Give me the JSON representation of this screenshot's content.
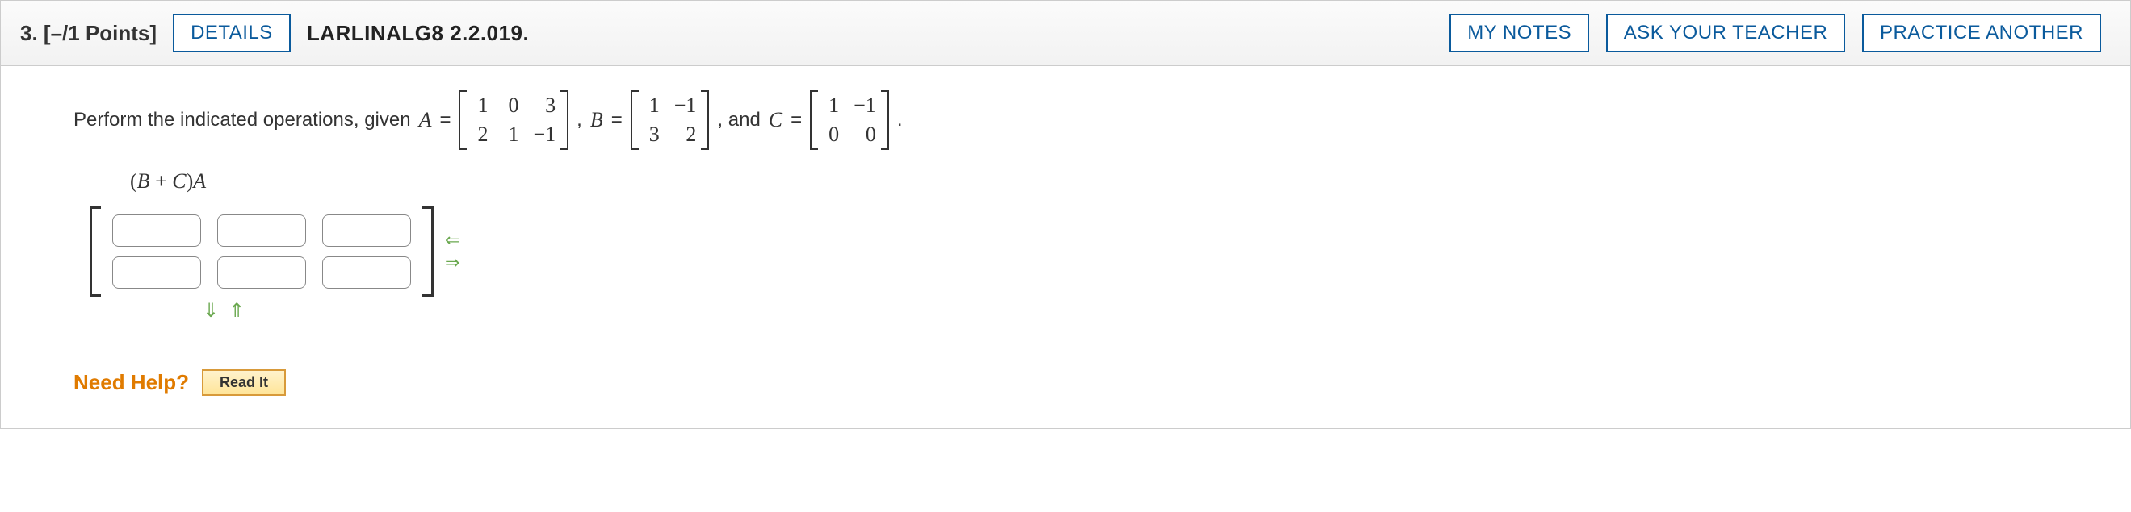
{
  "header": {
    "qnum": "3.",
    "points": "[–/1 Points]",
    "details_label": "DETAILS",
    "source": "LARLINALG8 2.2.019.",
    "my_notes": "MY NOTES",
    "ask_teacher": "ASK YOUR TEACHER",
    "practice": "PRACTICE ANOTHER"
  },
  "prompt": {
    "lead": "Perform the indicated operations, given ",
    "A_eq": "A",
    "eq": " = ",
    "B_eq": "B",
    "and": ",  and ",
    "C_eq": "C",
    "period": "."
  },
  "matrices": {
    "A": [
      [
        "1",
        "0",
        "3"
      ],
      [
        "2",
        "1",
        "−1"
      ]
    ],
    "B": [
      [
        "1",
        "−1"
      ],
      [
        "3",
        "2"
      ]
    ],
    "C": [
      [
        "1",
        "−1"
      ],
      [
        "0",
        "0"
      ]
    ]
  },
  "expression": "(B + C)A",
  "help": {
    "label": "Need Help?",
    "read": "Read It"
  }
}
